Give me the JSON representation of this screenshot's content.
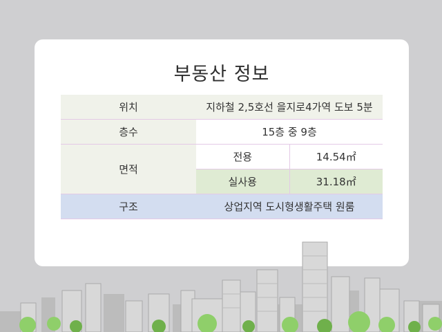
{
  "title": "부동산 정보",
  "rows": {
    "location": {
      "label": "위치",
      "value": "지하철 2,5호선 을지로4가역 도보 5분"
    },
    "floors": {
      "label": "층수",
      "value": "15층 중 9층"
    },
    "area": {
      "label": "면적",
      "exclusive": {
        "label": "전용",
        "value": "14.54㎡"
      },
      "actual": {
        "label": "실사용",
        "value": "31.18㎡"
      }
    },
    "structure": {
      "label": "구조",
      "value": "상업지역 도시형생활주택 원룸"
    }
  },
  "colors": {
    "background": "#cfcfd1",
    "row_light_green": "#f0f2ea",
    "row_green": "#dfebd3",
    "row_blue": "#d3ddf0",
    "divider": "#e3c9e6"
  }
}
